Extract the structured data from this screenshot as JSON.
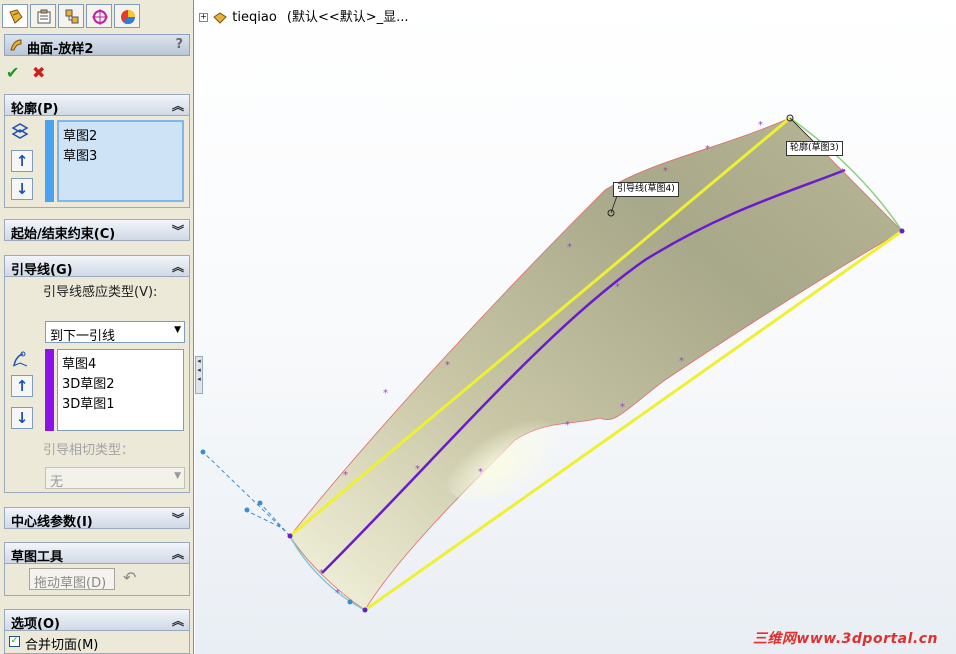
{
  "feature": {
    "title": "曲面-放样2",
    "help": "?"
  },
  "actions": {
    "ok": "✔",
    "cancel": "✖"
  },
  "profiles": {
    "header": "轮廓(P)",
    "items": [
      "草图2",
      "草图3"
    ]
  },
  "start_end": {
    "header": "起始/结束约束(C)"
  },
  "guides": {
    "header": "引导线(G)",
    "influence_label": "引导线感应类型(V):",
    "influence_value": "到下一引线",
    "items": [
      "草图4",
      "3D草图2",
      "3D草图1"
    ],
    "tangency_label": "引导相切类型：",
    "tangency_value": "无"
  },
  "centerline": {
    "header": "中心线参数(I)"
  },
  "sketch_tools": {
    "header": "草图工具",
    "drag_button": "拖动草图(D)"
  },
  "options": {
    "header": "选项(O)",
    "merge_label": "合并切面(M)",
    "merge_checked": true
  },
  "tree": {
    "part_name": "tieqiao",
    "config": "(默认<<默认>_显..."
  },
  "callouts": {
    "guide": "引导线(草图4)",
    "profile": "轮廓(草图3)"
  },
  "watermark": "三维网www.3dportal.cn",
  "colors": {
    "guide_bar": "#8a14e6",
    "profile_bar": "#4aa3f0",
    "edge_yellow": "#f0f032",
    "guide_purple": "#6a1ccc"
  }
}
